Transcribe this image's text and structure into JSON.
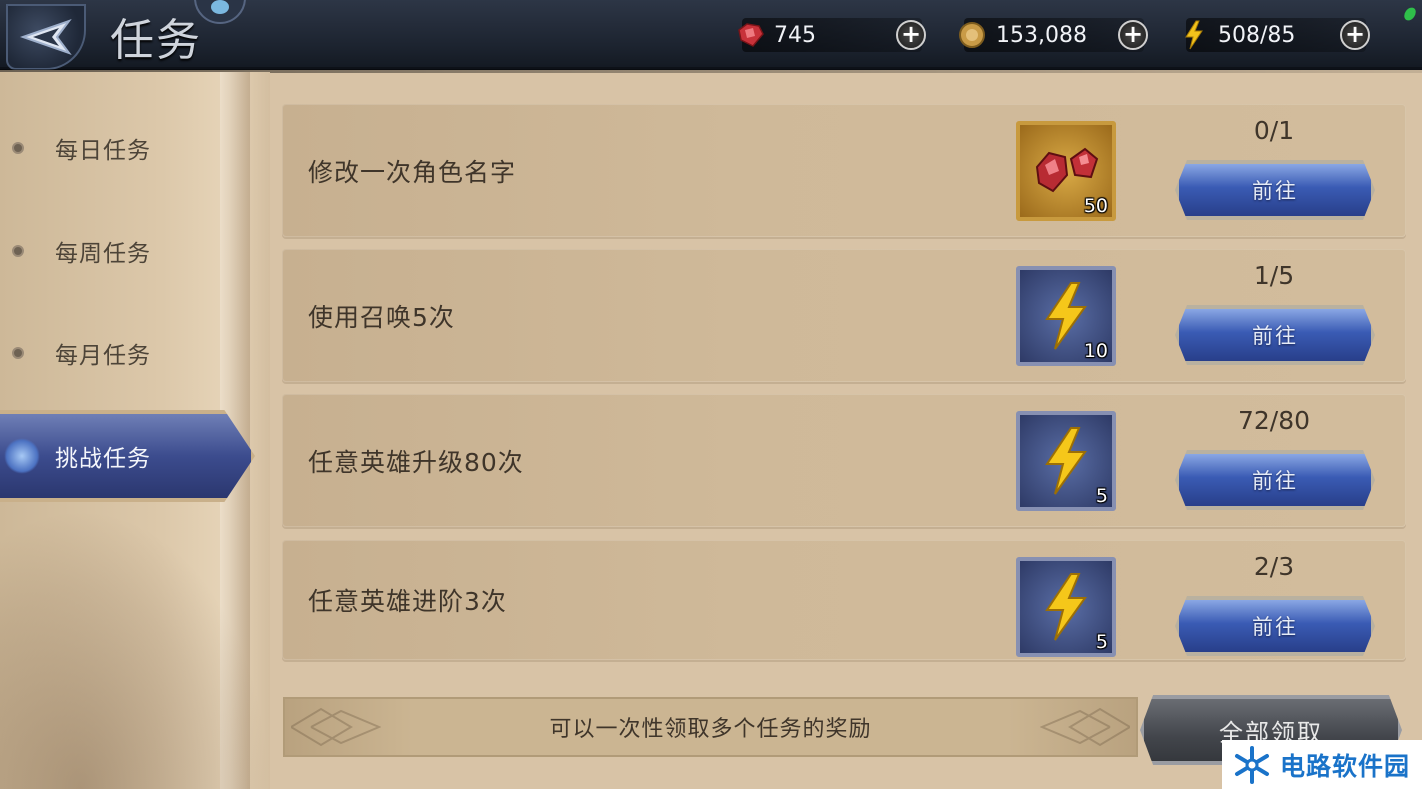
{
  "header": {
    "title": "任务",
    "resources": [
      {
        "icon": "ruby-gem-icon",
        "value": "745"
      },
      {
        "icon": "gold-coin-icon",
        "value": "153,088"
      },
      {
        "icon": "lightning-energy-icon",
        "value": "508/85"
      }
    ]
  },
  "sidebar": {
    "items": [
      {
        "label": "每日任务",
        "active": false
      },
      {
        "label": "每周任务",
        "active": false
      },
      {
        "label": "每月任务",
        "active": false
      },
      {
        "label": "挑战任务",
        "active": true
      }
    ]
  },
  "tasks": [
    {
      "name": "修改一次角色名字",
      "reward_icon": "ruby-gem-icon",
      "reward_qty": "50",
      "progress": "0/1",
      "button": "前往"
    },
    {
      "name": "使用召唤5次",
      "reward_icon": "lightning-energy-icon",
      "reward_qty": "10",
      "progress": "1/5",
      "button": "前往"
    },
    {
      "name": "任意英雄升级80次",
      "reward_icon": "lightning-energy-icon",
      "reward_qty": "5",
      "progress": "72/80",
      "button": "前往"
    },
    {
      "name": "任意英雄进阶3次",
      "reward_icon": "lightning-energy-icon",
      "reward_qty": "5",
      "progress": "2/3",
      "button": "前往"
    }
  ],
  "footer": {
    "hint": "可以一次性领取多个任务的奖励",
    "claim_all": "全部领取"
  },
  "watermark": {
    "text": "电路软件园"
  },
  "colors": {
    "accent_blue": "#3a5bb4",
    "parchment": "#d2bc9c",
    "text_dark": "#3f352a",
    "watermark_blue": "#1a73c9"
  }
}
